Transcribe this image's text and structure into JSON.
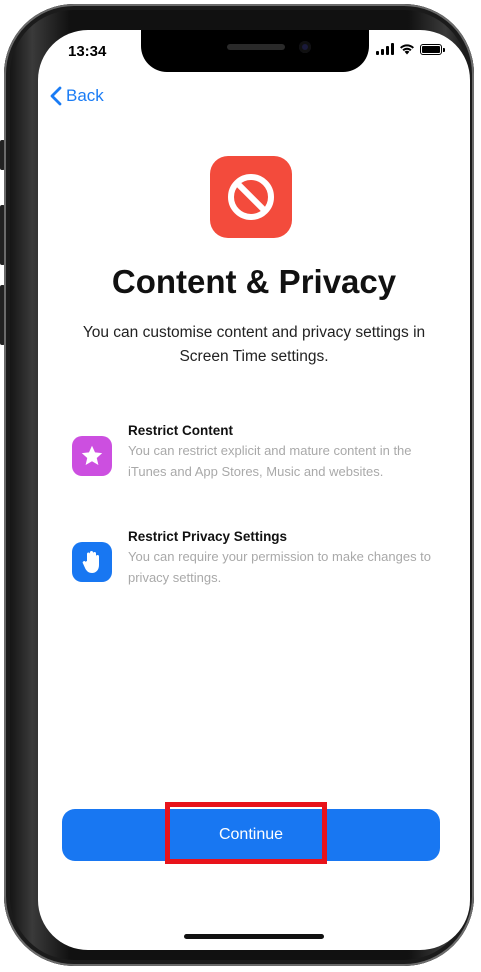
{
  "status_bar": {
    "time": "13:34"
  },
  "nav": {
    "back_label": "Back"
  },
  "header": {
    "title": "Content & Privacy",
    "subtitle": "You can customise content and privacy settings in Screen Time settings."
  },
  "features": [
    {
      "title": "Restrict Content",
      "description": "You can restrict explicit and mature content in the iTunes and App Stores, Music and websites.",
      "icon": "star-icon",
      "color": "#cc4fe0"
    },
    {
      "title": "Restrict Privacy Settings",
      "description": "You can require your permission to make changes to privacy settings.",
      "icon": "hand-icon",
      "color": "#1877f2"
    }
  ],
  "continue_button": {
    "label": "Continue",
    "color": "#1877f2"
  },
  "app_icon": {
    "name": "restriction-icon",
    "color": "#f34b3c"
  },
  "annotation": {
    "highlight_color": "#e8131b"
  }
}
